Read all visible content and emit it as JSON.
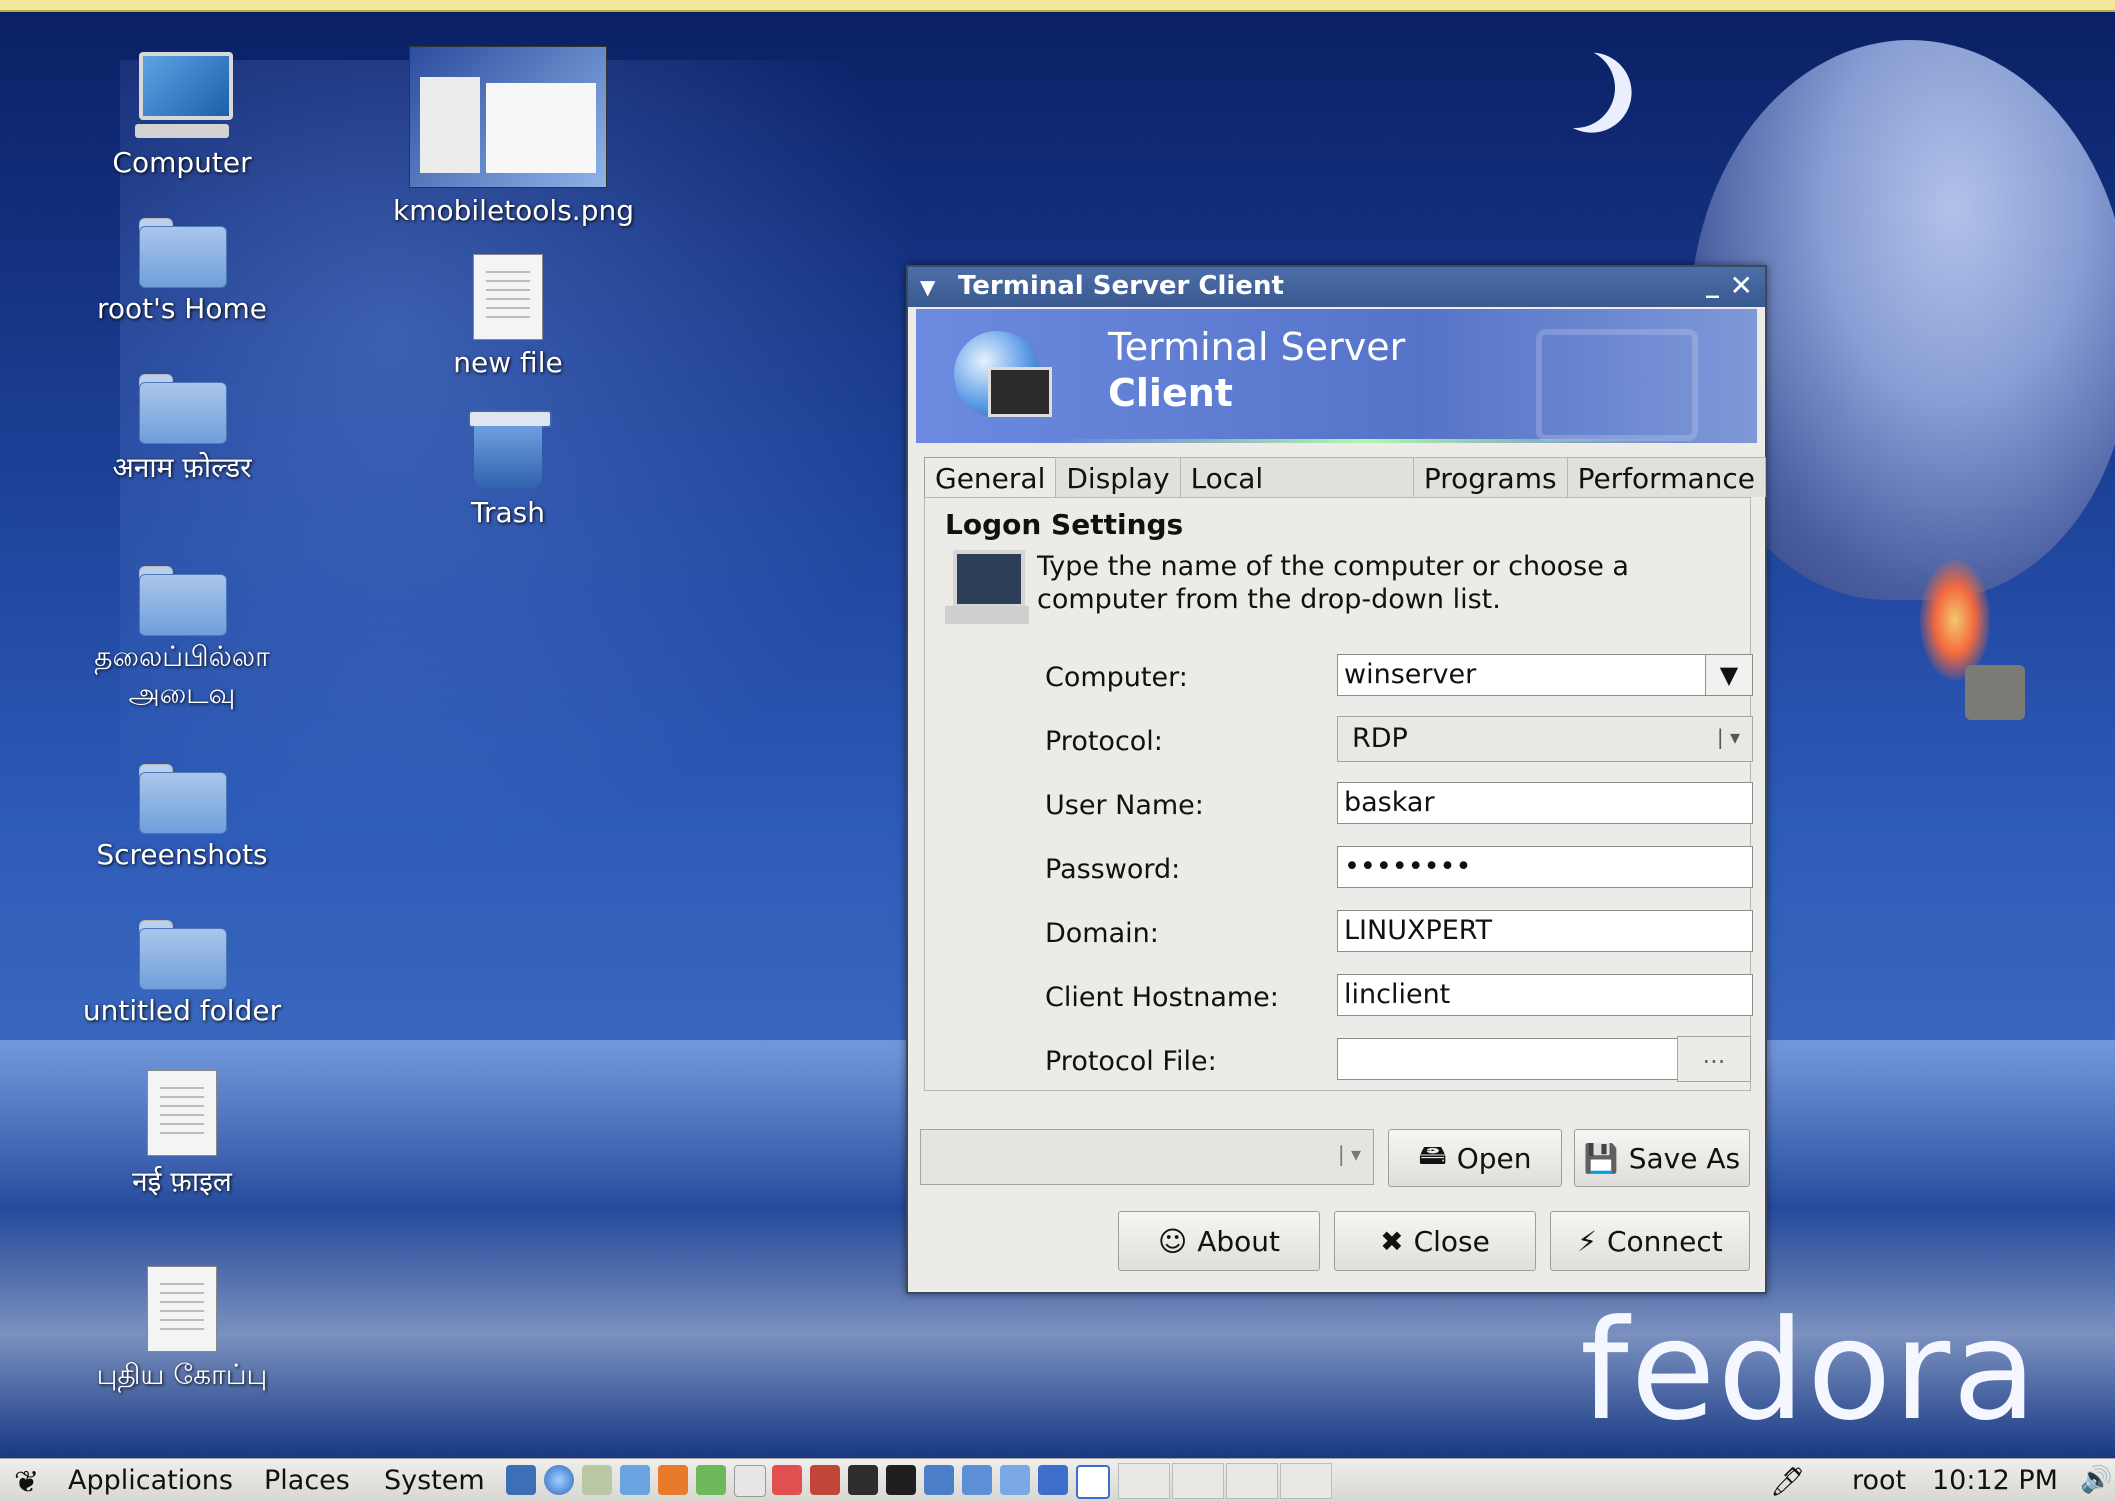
{
  "window": {
    "title": "Terminal Server Client",
    "banner_line1": "Terminal Server",
    "banner_line2": "Client",
    "tabs": [
      "General",
      "Display",
      "Local Resources",
      "Programs",
      "Performance"
    ],
    "section_title": "Logon Settings",
    "description_line1": "Type the name of the computer or choose a",
    "description_line2": "computer from the drop-down list.",
    "fields": {
      "computer_label": "Computer:",
      "computer_value": "winserver",
      "protocol_label": "Protocol:",
      "protocol_value": "RDP",
      "username_label": "User Name:",
      "username_value": "baskar",
      "password_label": "Password:",
      "password_value": "••••••••",
      "domain_label": "Domain:",
      "domain_value": "LINUXPERT",
      "hostname_label": "Client Hostname:",
      "hostname_value": "linclient",
      "protocol_file_label": "Protocol File:",
      "protocol_file_value": "",
      "browse_label": "..."
    },
    "buttons": {
      "open": "Open",
      "save_as": "Save As",
      "about": "About",
      "close": "Close",
      "connect": "Connect"
    }
  },
  "desktop_icons": [
    {
      "label": "Computer",
      "icon": "computer-icon"
    },
    {
      "label": "root's Home",
      "icon": "home-folder-icon"
    },
    {
      "label": "अनाम फ़ोल्डर",
      "icon": "folder-icon"
    },
    {
      "label_line1": "தலைப்பில்லா",
      "label_line2": "அடைவு",
      "icon": "folder-icon"
    },
    {
      "label": "Screenshots",
      "icon": "folder-icon"
    },
    {
      "label": "untitled folder",
      "icon": "folder-icon"
    },
    {
      "label": "नई फ़ाइल",
      "icon": "document-icon"
    },
    {
      "label": "புதிய கோப்பு",
      "icon": "document-icon"
    },
    {
      "label": "kmobiletools.png",
      "icon": "image-thumbnail-icon"
    },
    {
      "label": "new file",
      "icon": "document-icon"
    },
    {
      "label": "Trash",
      "icon": "trash-icon"
    }
  ],
  "taskbar": {
    "menus": [
      "Applications",
      "Places",
      "System"
    ],
    "user": "root",
    "clock": "10:12 PM"
  },
  "wallpaper_text": "fedora"
}
